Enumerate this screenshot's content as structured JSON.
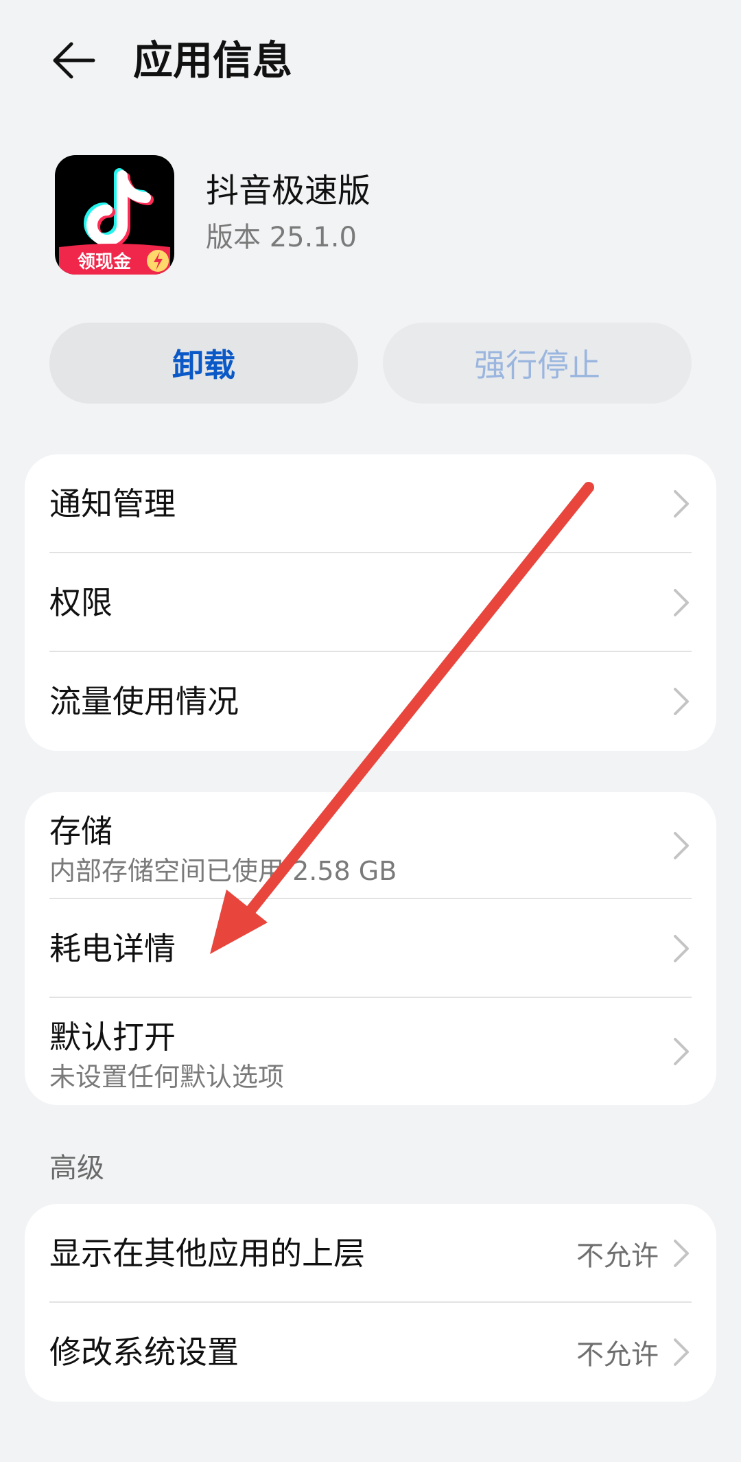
{
  "header": {
    "title": "应用信息",
    "back_icon": "back-arrow-icon"
  },
  "app": {
    "name": "抖音极速版",
    "version": "版本 25.1.0",
    "icon_badge_text": "领现金"
  },
  "actions": {
    "uninstall_label": "卸载",
    "force_stop_label": "强行停止"
  },
  "group1": {
    "items": [
      {
        "title": "通知管理"
      },
      {
        "title": "权限"
      },
      {
        "title": "流量使用情况"
      }
    ]
  },
  "group2": {
    "items": [
      {
        "title": "存储",
        "subtitle": "内部存储空间已使用 2.58 GB"
      },
      {
        "title": "耗电详情"
      },
      {
        "title": "默认打开",
        "subtitle": "未设置任何默认选项"
      }
    ]
  },
  "advanced": {
    "label": "高级",
    "items": [
      {
        "title": "显示在其他应用的上层",
        "value": "不允许"
      },
      {
        "title": "修改系统设置",
        "value": "不允许"
      }
    ]
  },
  "colors": {
    "background": "#f1f3f5",
    "accent": "#0a59c7",
    "annotation_arrow": "#e8453c"
  }
}
